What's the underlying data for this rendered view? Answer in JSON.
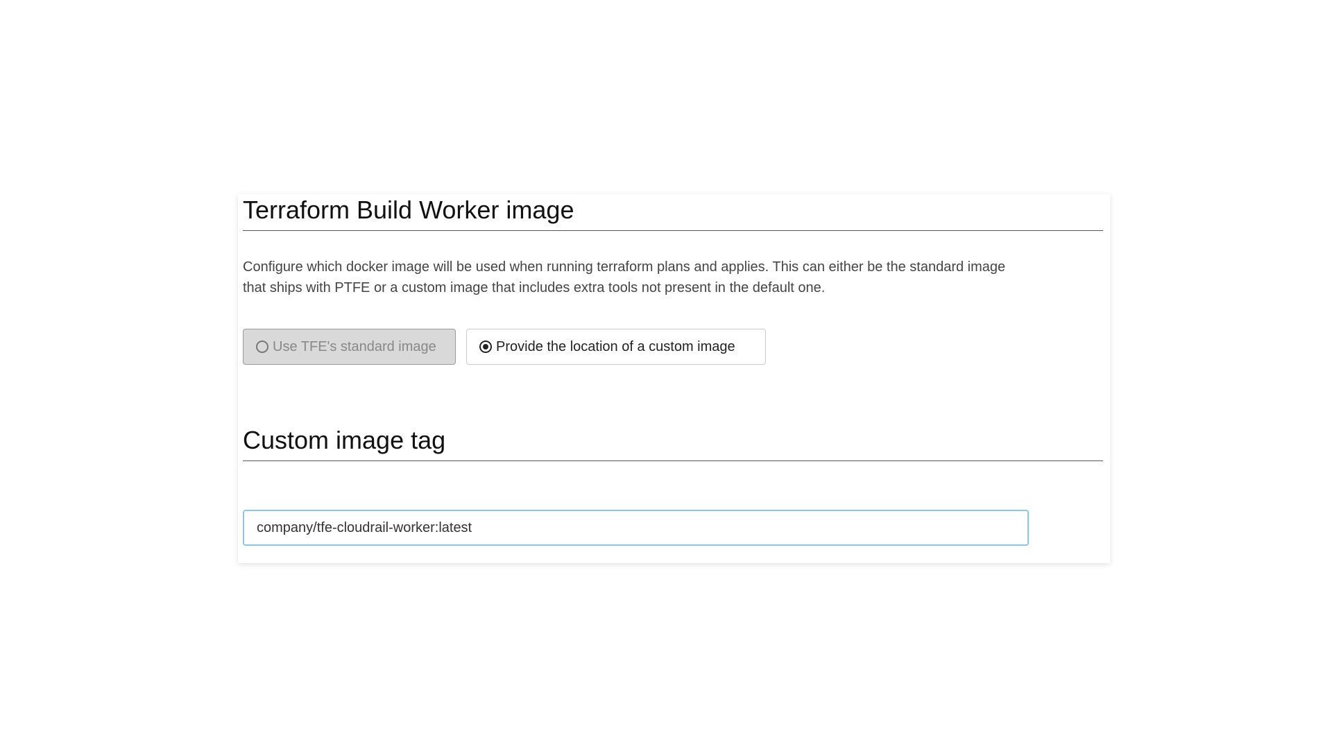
{
  "build_worker": {
    "title": "Terraform Build Worker image",
    "description": "Configure which docker image will be used when running terraform plans and applies. This can either be the standard image that ships with PTFE or a custom image that includes extra tools not present in the default one.",
    "options": [
      {
        "label": "Use TFE's standard image",
        "selected": false
      },
      {
        "label": "Provide the location of a custom image",
        "selected": true
      }
    ]
  },
  "custom_image": {
    "title": "Custom image tag",
    "value": "company/tfe-cloudrail-worker:latest"
  }
}
